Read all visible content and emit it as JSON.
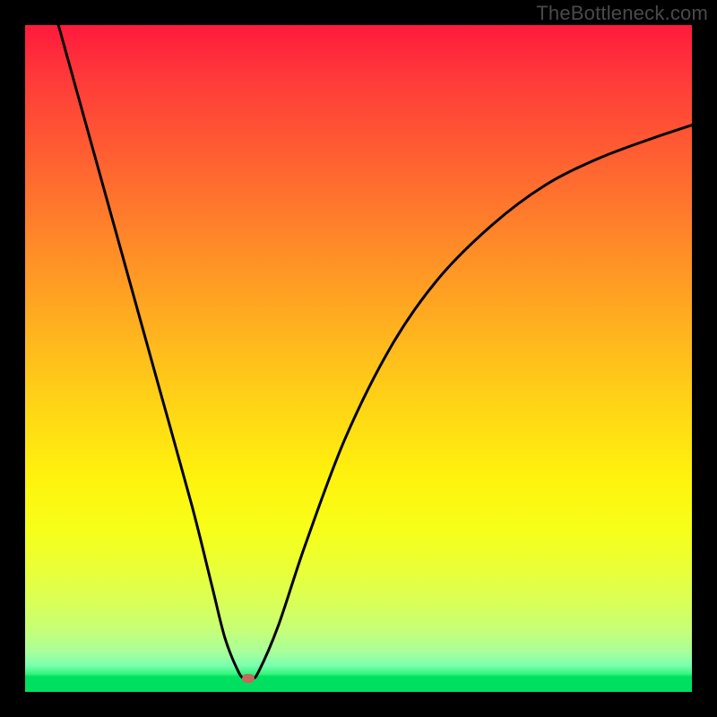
{
  "watermark": "TheBottleneck.com",
  "chart_data": {
    "type": "line",
    "title": "",
    "xlabel": "",
    "ylabel": "",
    "xlim": [
      0,
      100
    ],
    "ylim": [
      0,
      100
    ],
    "grid": false,
    "legend": false,
    "series": [
      {
        "name": "curve",
        "x": [
          5,
          10,
          15,
          20,
          25,
          28,
          30,
          32,
          33,
          34,
          35,
          38,
          42,
          48,
          55,
          62,
          70,
          78,
          86,
          94,
          100
        ],
        "y": [
          100,
          82,
          64,
          46,
          28,
          16,
          8,
          3,
          2,
          2,
          3,
          10,
          22,
          38,
          52,
          62,
          70,
          76,
          80,
          83,
          85
        ]
      }
    ],
    "marker": {
      "x": 33.5,
      "y": 2
    },
    "background_gradient": {
      "top": "#ff1a3c",
      "bottom": "#00e060"
    }
  }
}
